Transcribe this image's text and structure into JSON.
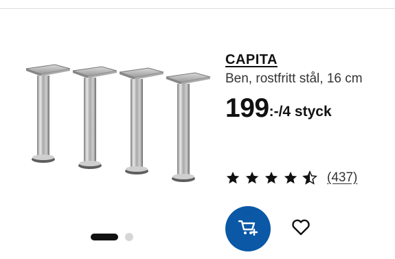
{
  "product": {
    "name": "CAPITA",
    "description": "Ben, rostfritt stål, 16 cm",
    "price": "199",
    "price_unit": ":-/4 styck"
  },
  "rating": {
    "value": 4.5,
    "max": 5,
    "count_label": "(437)"
  },
  "carousel": {
    "active_index": 0,
    "total": 2
  },
  "colors": {
    "cart_button": "#0a58a6",
    "text": "#111111"
  },
  "icons": {
    "cart": "shopping-cart-add-icon",
    "favorite": "heart-icon",
    "star": "star-icon"
  }
}
